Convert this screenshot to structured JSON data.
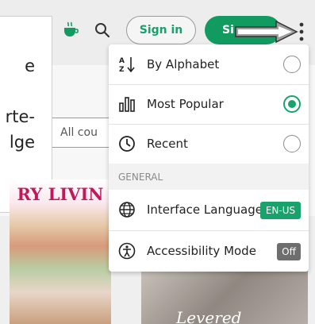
{
  "header": {
    "signin_label": "Sign in",
    "signup_label": "Si",
    "coffee_icon": "coffee-cup-icon",
    "search_icon": "search-icon",
    "more_icon": "kebab-menu-icon"
  },
  "background": {
    "card_text_lines": [
      "e",
      "rte-",
      "lge"
    ],
    "country_select_value": "All cou",
    "magazine_title": "RY LIVIN",
    "magazine_script": "Levered"
  },
  "menu": {
    "sort_options": [
      {
        "label": "By Alphabet",
        "icon": "sort-alphabet-icon",
        "selected": false
      },
      {
        "label": "Most Popular",
        "icon": "bar-chart-icon",
        "selected": true
      },
      {
        "label": "Recent",
        "icon": "clock-icon",
        "selected": false
      }
    ],
    "section_title": "GENERAL",
    "general_items": [
      {
        "label": "Interface Language",
        "icon": "globe-icon",
        "badge": "EN-US"
      },
      {
        "label": "Accessibility Mode",
        "icon": "accessibility-icon",
        "badge": "Off"
      }
    ]
  },
  "colors": {
    "accent_green": "#17a36b",
    "signup_green": "#129b60",
    "off_badge_gray": "#6e6e6e",
    "magazine_pink": "#c2185b"
  }
}
